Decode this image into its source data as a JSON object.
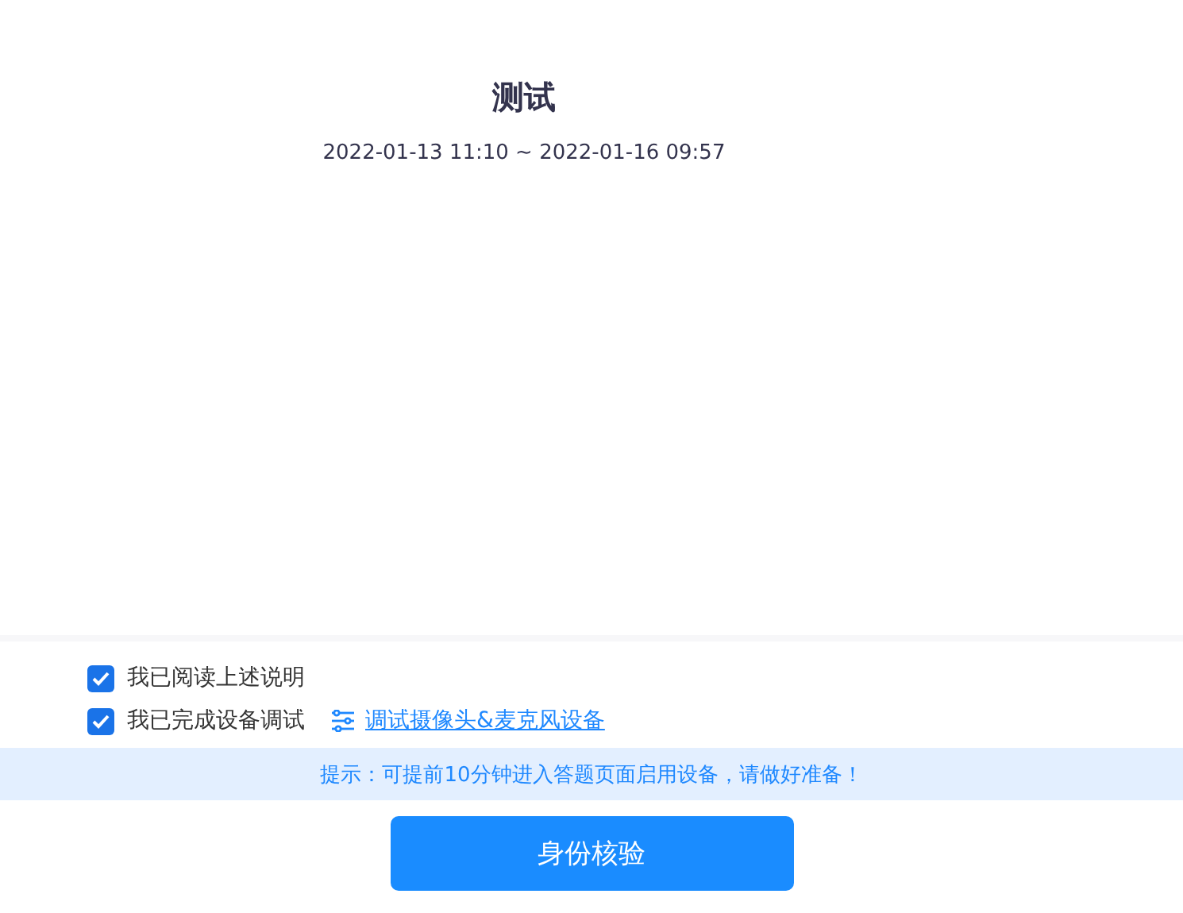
{
  "exam": {
    "title": "测试",
    "time_range": "2022-01-13 11:10 ~ 2022-01-16 09:57"
  },
  "confirmations": [
    {
      "label": "我已阅读上述说明",
      "checked": true
    },
    {
      "label": "我已完成设备调试",
      "checked": true,
      "link": "调试摄像头&麦克风设备"
    }
  ],
  "tip": "提示：可提前10分钟进入答题页面启用设备，请做好准备！",
  "button": "身份核验"
}
